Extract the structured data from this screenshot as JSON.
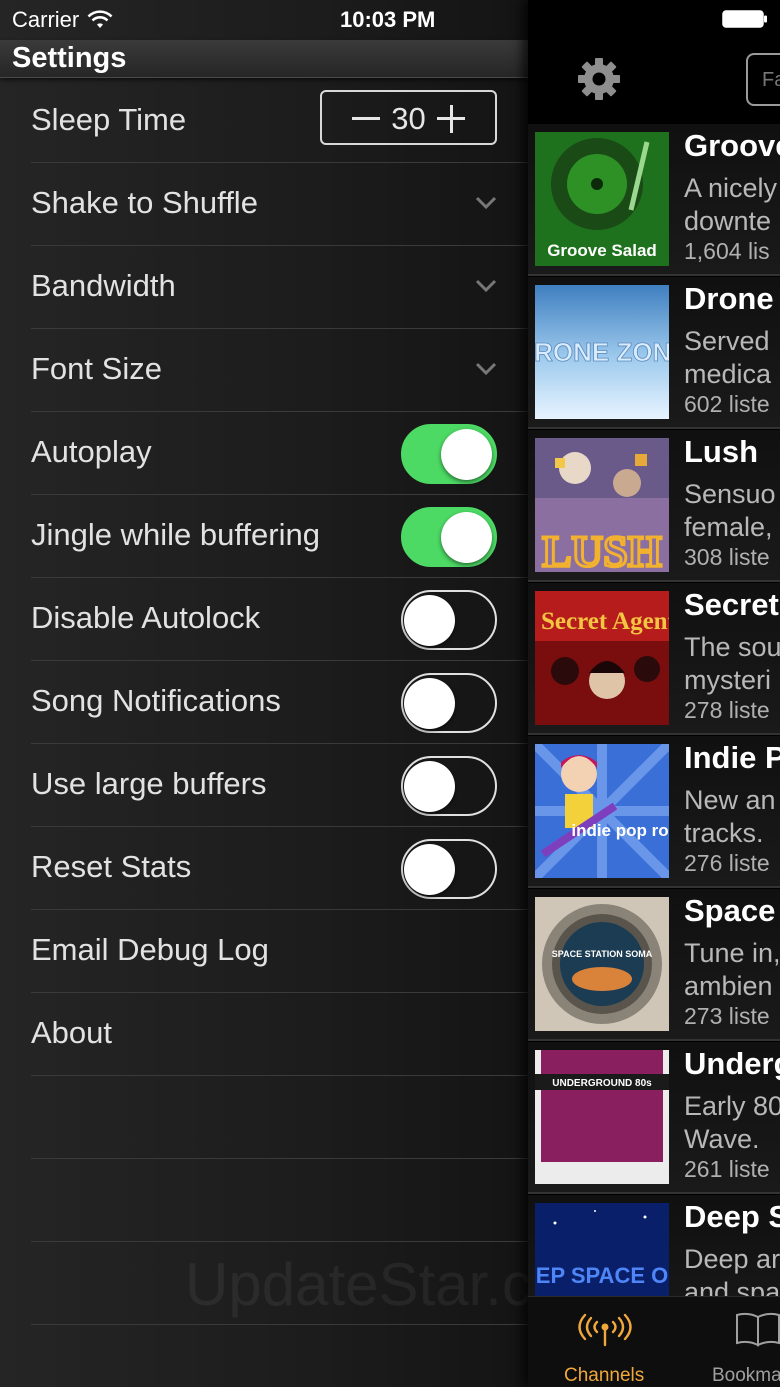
{
  "status_bar": {
    "carrier": "Carrier",
    "time": "10:03 PM"
  },
  "settings": {
    "title": "Settings",
    "sleep_time": {
      "label": "Sleep Time",
      "value": "30"
    },
    "rows": [
      {
        "label": "Shake to Shuffle",
        "control": "chevron"
      },
      {
        "label": "Bandwidth",
        "control": "chevron"
      },
      {
        "label": "Font Size",
        "control": "chevron"
      },
      {
        "label": "Autoplay",
        "control": "toggle",
        "on": true
      },
      {
        "label": "Jingle while buffering",
        "control": "toggle",
        "on": true
      },
      {
        "label": "Disable Autolock",
        "control": "toggle",
        "on": false
      },
      {
        "label": "Song Notifications",
        "control": "toggle",
        "on": false
      },
      {
        "label": "Use large buffers",
        "control": "toggle",
        "on": false
      },
      {
        "label": "Reset Stats",
        "control": "toggle",
        "on": false
      },
      {
        "label": "Email Debug Log",
        "control": "none"
      },
      {
        "label": "About",
        "control": "none"
      }
    ],
    "watermark": "UpdateStar.com"
  },
  "channels_panel": {
    "search_placeholder": "Fa",
    "channels": [
      {
        "title": "Groove",
        "desc": [
          "A nicely",
          "downte"
        ],
        "listeners": "1,604 lis",
        "art_text": "Groove Salad"
      },
      {
        "title": "Drone",
        "desc": [
          "Served",
          "medica"
        ],
        "listeners": "602 liste",
        "art_text": "DRONE ZONE"
      },
      {
        "title": "Lush",
        "desc": [
          "Sensuo",
          "female,"
        ],
        "listeners": "308 liste",
        "art_text": "LUSH"
      },
      {
        "title": "Secret",
        "desc": [
          "The sou",
          "mysteri"
        ],
        "listeners": "278 liste",
        "art_text": "Secret Agent"
      },
      {
        "title": "Indie P",
        "desc": [
          "New an",
          "tracks."
        ],
        "listeners": "276 liste",
        "art_text": "indie pop rocks!"
      },
      {
        "title": "Space",
        "desc": [
          "Tune in,",
          "ambien"
        ],
        "listeners": "273 liste",
        "art_text": "SPACE STATION SOMA"
      },
      {
        "title": "Underg",
        "desc": [
          "Early 80",
          "Wave."
        ],
        "listeners": "261 liste",
        "art_text": "UNDERGROUND 80s"
      },
      {
        "title": "Deep S",
        "desc": [
          "Deep ar",
          "and spa"
        ],
        "listeners": "",
        "art_text": "DEEP SPACE ONE"
      }
    ],
    "tabs": [
      {
        "label": "Channels",
        "active": true
      },
      {
        "label": "Bookma",
        "active": false
      }
    ]
  },
  "colors": {
    "toggle_on": "#4cd964",
    "tab_active": "#f0a83c"
  }
}
